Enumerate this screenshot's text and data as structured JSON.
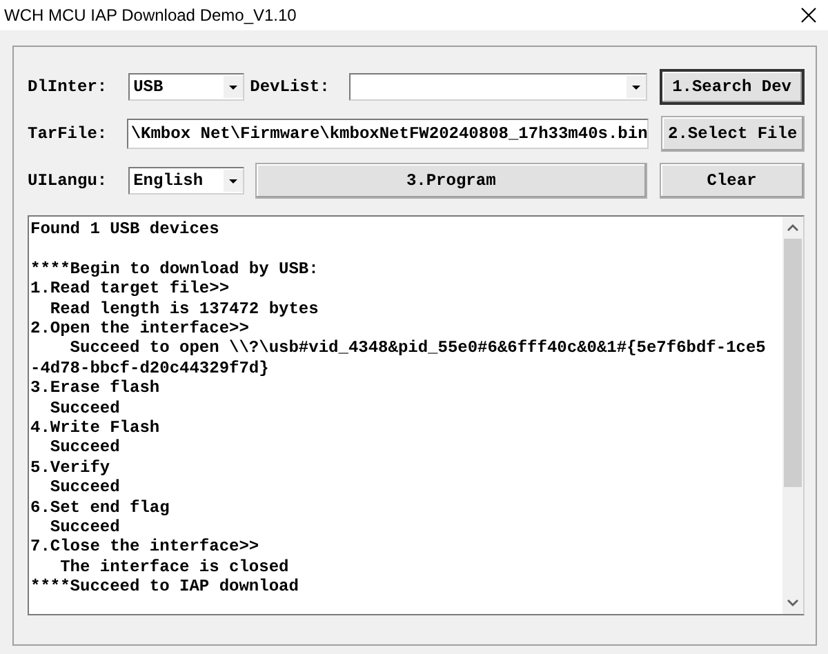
{
  "window": {
    "title": "WCH MCU IAP Download Demo_V1.10"
  },
  "dl_inter": {
    "label": "DlInter:",
    "value": "USB"
  },
  "dev_list": {
    "label": "DevList:"
  },
  "search_button": {
    "label": "1.Search Dev",
    "default": true
  },
  "tar_file": {
    "label": "TarFile:",
    "value": "\\Kmbox Net\\Firmware\\kmboxNetFW20240808_17h33m40s.bin"
  },
  "select_button": {
    "label": "2.Select File",
    "default": false
  },
  "ui_langu": {
    "label": "UILangu:",
    "value": "English"
  },
  "program_button": {
    "label": "3.Program",
    "default": false
  },
  "clear_button": {
    "label": "Clear",
    "default": false
  },
  "log_blocks": [
    {
      "lines": [
        "Found 1 USB devices"
      ]
    },
    {
      "lines": [
        "****Begin to download by USB:",
        "1.Read target file>>",
        "  Read length is 137472 bytes",
        "2.Open the interface>>",
        "    Succeed to open \\\\?\\usb#vid_4348&pid_55e0#6&6fff40c&0&1#{5e7f6bdf-1ce5",
        "-4d78-bbcf-d20c44329f7d}",
        "3.Erase flash",
        "  Succeed",
        "4.Write Flash",
        "  Succeed",
        "5.Verify",
        "  Succeed",
        "6.Set end flag",
        "  Succeed",
        "7.Close the interface>>",
        "   The interface is closed",
        "****Succeed to IAP download"
      ]
    }
  ]
}
